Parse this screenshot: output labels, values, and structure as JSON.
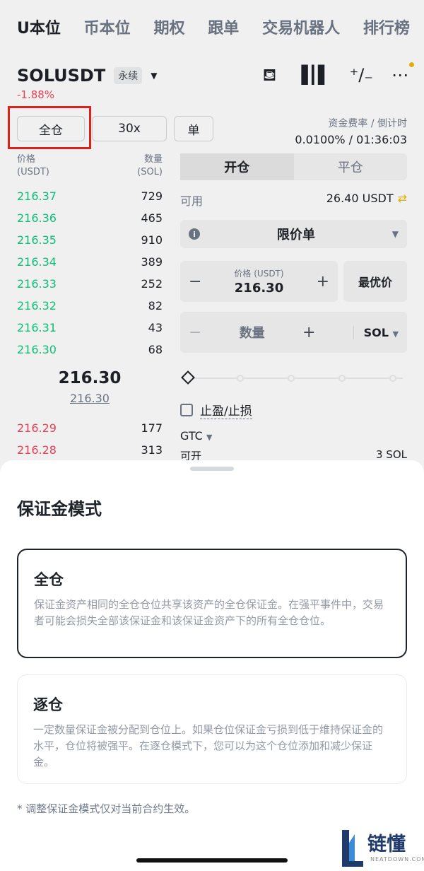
{
  "nav": {
    "items": [
      "U本位",
      "币本位",
      "期权",
      "跟单",
      "交易机器人",
      "排行榜"
    ]
  },
  "pair": {
    "symbol": "SOLUSDT",
    "tag": "永续",
    "change": "-1.88%"
  },
  "mode": {
    "cross": "全仓",
    "leverage": "30x",
    "single": "单"
  },
  "funding": {
    "label": "资金费率 / 倒计时",
    "value": "0.0100% / 01:36:03"
  },
  "orderbook": {
    "price_label": "价格",
    "price_unit": "(USDT)",
    "qty_label": "数量",
    "qty_unit": "(SOL)",
    "upper": [
      {
        "price": "216.37",
        "qty": "729"
      },
      {
        "price": "216.36",
        "qty": "465"
      },
      {
        "price": "216.35",
        "qty": "910"
      },
      {
        "price": "216.34",
        "qty": "389"
      },
      {
        "price": "216.33",
        "qty": "252"
      },
      {
        "price": "216.32",
        "qty": "82"
      },
      {
        "price": "216.31",
        "qty": "43"
      },
      {
        "price": "216.30",
        "qty": "68"
      }
    ],
    "last_price": "216.30",
    "mark_price": "216.30",
    "lower": [
      {
        "price": "216.29",
        "qty": "177"
      },
      {
        "price": "216.28",
        "qty": "313"
      }
    ]
  },
  "order": {
    "tab_open": "开仓",
    "tab_close": "平仓",
    "avail_label": "可用",
    "avail_value": "26.40 USDT",
    "type": "限价单",
    "price_label": "价格 (USDT)",
    "price_value": "216.30",
    "best_price": "最优价",
    "qty_placeholder": "数量",
    "qty_unit": "SOL",
    "tpsl": "止盈/止损",
    "tif": "GTC",
    "can_open_label": "可开",
    "can_open_value": "3 SOL"
  },
  "sheet": {
    "title": "保证金模式",
    "cross_title": "全仓",
    "cross_desc": "保证金资产相同的全仓仓位共享该资产的全仓保证金。在强平事件中，交易者可能会损失全部该保证金和该保证金资产下的所有全仓仓位。",
    "isolated_title": "逐仓",
    "isolated_desc": "一定数量保证金被分配到仓位上。如果仓位保证金亏损到低于维持保证金的水平，仓位将被强平。在逐仓模式下，您可以为这个仓位添加和减少保证金。",
    "note": "* 调整保证金模式仅对当前合约生效。"
  },
  "watermark": {
    "text": "链懂",
    "sub": "NEATDOWN.COM"
  },
  "colors": {
    "bid": "#0ecb81",
    "ask": "#f6465d",
    "accent": "#f0b90b",
    "highlight": "#e8241e"
  }
}
